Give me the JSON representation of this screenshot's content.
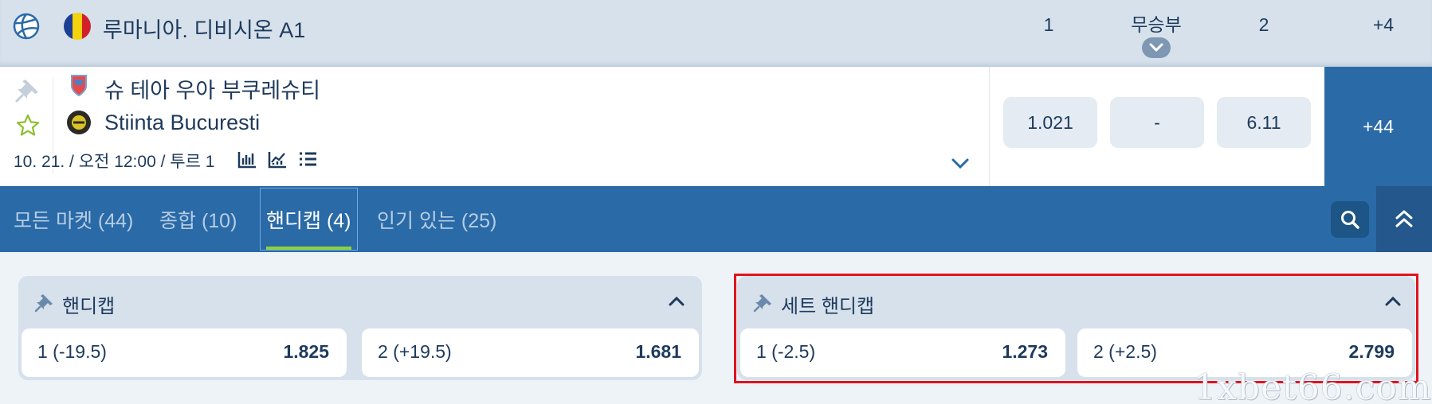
{
  "league": {
    "sport_icon": "volleyball-icon",
    "flag_icon": "romania-flag-icon",
    "title": "루마니아. 디비시온 A1",
    "columns": {
      "home": "1",
      "draw": "무승부",
      "away": "2",
      "more": "+4"
    }
  },
  "match": {
    "team1": {
      "name": "슈 테아 우아 부쿠레슈티",
      "logo_icon": "team1-crest-icon"
    },
    "team2": {
      "name": "Stiinta Bucuresti",
      "logo_icon": "team2-crest-icon"
    },
    "meta": "10. 21. / 오전 12:00 / 투르 1",
    "odds": {
      "home": "1.021",
      "draw": "-",
      "away": "6.11"
    },
    "more_markets": "+44"
  },
  "tabs": [
    {
      "label": "모든 마켓 (44)"
    },
    {
      "label": "종합 (10)"
    },
    {
      "label": "핸디캡 (4)"
    },
    {
      "label": "인기 있는 (25)"
    }
  ],
  "active_tab": 2,
  "markets": [
    {
      "title": "핸디캡",
      "outcomes": [
        {
          "label": "1 (-19.5)",
          "odd": "1.825"
        },
        {
          "label": "2 (+19.5)",
          "odd": "1.681"
        }
      ]
    },
    {
      "title": "세트 핸디캡",
      "highlighted": true,
      "outcomes": [
        {
          "label": "1 (-2.5)",
          "odd": "1.273"
        },
        {
          "label": "2 (+2.5)",
          "odd": "2.799"
        }
      ]
    }
  ],
  "watermark": "1xbet66.com",
  "colors": {
    "header_bg": "#d6e1ec",
    "tabs_bg": "#2a6aa7",
    "accent_underline": "#8cd13c",
    "highlight_border": "#e0141c",
    "text": "#1e3a5c"
  }
}
